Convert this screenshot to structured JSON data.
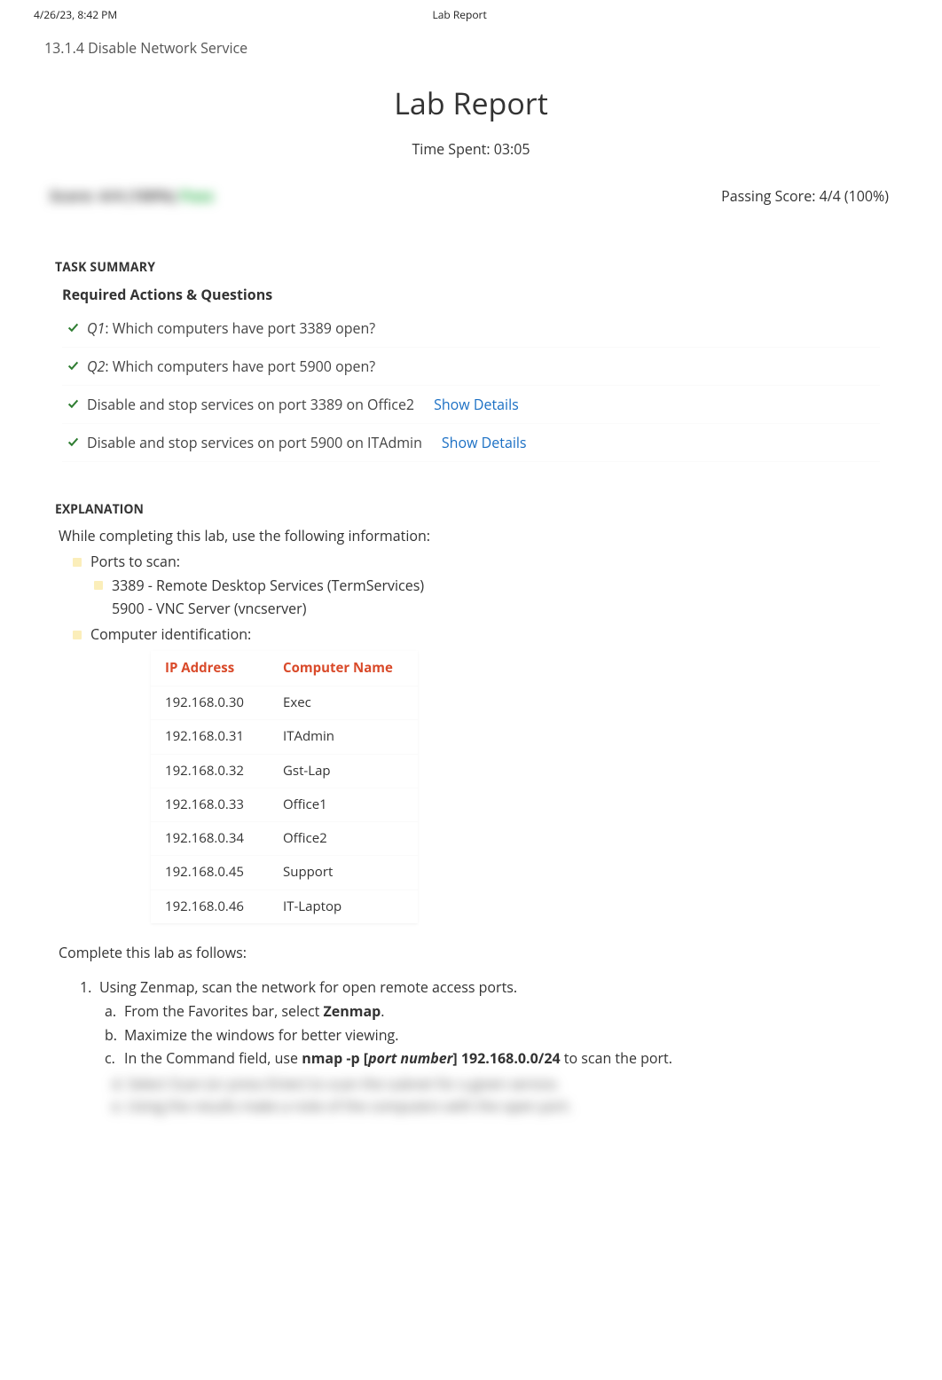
{
  "header": {
    "left": "4/26/23, 8:42 PM",
    "center": "Lab Report"
  },
  "breadcrumb": "13.1.4 Disable Network Service",
  "title": "Lab Report",
  "time_spent": "Time Spent: 03:05",
  "score_blur": "Score: 4/4 (100%) ",
  "score_blur_pass": "Pass",
  "passing_score": "Passing Score: 4/4 (100%)",
  "task_summary_heading": "TASK SUMMARY",
  "required_heading": "Required Actions & Questions",
  "tasks": [
    {
      "q": "Q1",
      "text": ":  Which computers have port 3389 open?",
      "details": false
    },
    {
      "q": "Q2",
      "text": ":  Which computers have port 5900 open?",
      "details": false
    },
    {
      "q": "",
      "text": "Disable and stop services on port 3389 on Office2",
      "details": true
    },
    {
      "q": "",
      "text": "Disable and stop services on port 5900 on ITAdmin",
      "details": true
    }
  ],
  "show_details_label": "Show Details",
  "explanation_heading": "EXPLANATION",
  "explanation_intro": "While completing this lab, use the following information:",
  "ports_label": "Ports to scan:",
  "port_lines": [
    "3389 - Remote Desktop Services (TermServices)",
    "5900 - VNC Server (vncserver)"
  ],
  "computer_id_label": "Computer identification:",
  "table_headers": {
    "ip": "IP Address",
    "name": "Computer Name"
  },
  "computers": [
    {
      "ip": "192.168.0.30",
      "name": "Exec"
    },
    {
      "ip": "192.168.0.31",
      "name": "ITAdmin"
    },
    {
      "ip": "192.168.0.32",
      "name": "Gst-Lap"
    },
    {
      "ip": "192.168.0.33",
      "name": "Office1"
    },
    {
      "ip": "192.168.0.34",
      "name": "Office2"
    },
    {
      "ip": "192.168.0.45",
      "name": "Support"
    },
    {
      "ip": "192.168.0.46",
      "name": "IT-Laptop"
    }
  ],
  "complete_label": "Complete this lab as follows:",
  "steps": {
    "s1": {
      "num": "1.",
      "text": "Using Zenmap, scan the network for open remote access ports.",
      "a_num": "a.",
      "a_text_pre": "From the Favorites bar, select ",
      "a_bold": "Zenmap",
      "a_text_post": ".",
      "b_num": "b.",
      "b_text": "Maximize the windows for better viewing.",
      "c_num": "c.",
      "c_pre": "In the Command field, use ",
      "c_b1": "nmap -p [",
      "c_i": "port number",
      "c_b2": "] 192.168.0.0/24",
      "c_post": " to scan the port."
    }
  },
  "blur_lines": [
    "d. Select Scan (or press Enter) to scan the subnet for a given service.",
    "e. Using the results make a note of the computers with the open port."
  ]
}
